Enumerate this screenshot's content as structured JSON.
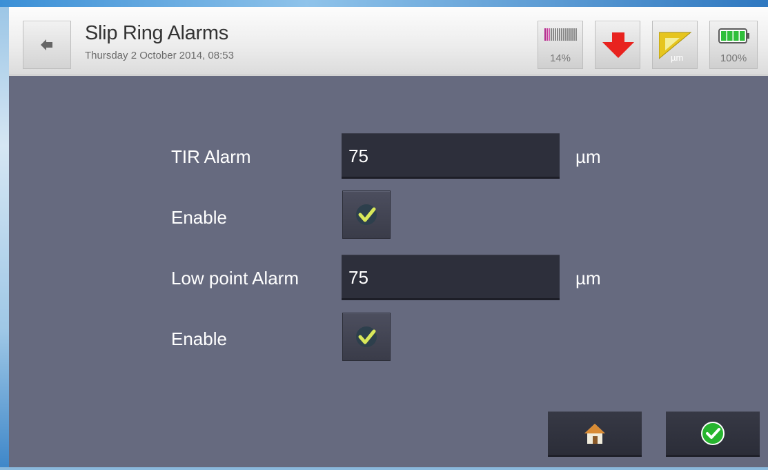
{
  "header": {
    "title": "Slip Ring Alarms",
    "datetime": "Thursday 2 October 2014, 08:53",
    "status": {
      "signal_level": "14%",
      "tolerance_unit": "µm",
      "battery_level": "100%"
    }
  },
  "form": {
    "tir_alarm": {
      "label": "TIR Alarm",
      "value": "75",
      "unit": "µm",
      "enable_label": "Enable",
      "enabled": true
    },
    "low_point_alarm": {
      "label": "Low point Alarm",
      "value": "75",
      "unit": "µm",
      "enable_label": "Enable",
      "enabled": true
    }
  },
  "icons": {
    "back": "back-arrow-icon",
    "signal": "signal-level-icon",
    "direction": "down-arrow-icon",
    "tolerance": "ruler-triangle-icon",
    "battery": "battery-icon",
    "home": "home-icon",
    "confirm": "check-circle-icon"
  },
  "colors": {
    "background": "#666a7f",
    "field": "#2d2f3b",
    "check": "#d9e85a",
    "arrow": "#e8231f",
    "ok": "#27b52f",
    "battery": "#2fbf3a"
  }
}
